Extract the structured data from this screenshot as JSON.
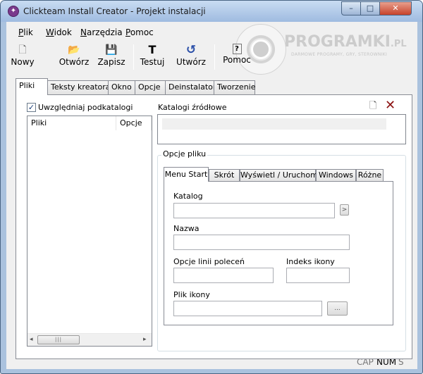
{
  "window": {
    "title": "Clickteam Install Creator - Projekt instalacji",
    "app_icon_glyph": "✦",
    "min_glyph": "–",
    "max_glyph": "□",
    "close_glyph": "✕"
  },
  "menu": [
    {
      "label": "Plik",
      "accel": "P",
      "rest": "lik"
    },
    {
      "label": "Widok",
      "accel": "W",
      "rest": "idok"
    },
    {
      "label": "Narzędzia",
      "accel": "N",
      "rest": "arzędzia"
    },
    {
      "label": "Pomoc",
      "accel": "P",
      "rest": "omoc"
    }
  ],
  "toolbar": {
    "new": {
      "label": "Nowy",
      "icon": "new-document-icon",
      "glyph": "🗋"
    },
    "open": {
      "label": "Otwórz",
      "icon": "open-folder-icon",
      "glyph": "📂"
    },
    "save": {
      "label": "Zapisz",
      "icon": "save-disk-icon",
      "glyph": "💾"
    },
    "test": {
      "label": "Testuj",
      "icon": "test-t-icon",
      "glyph": "T"
    },
    "build": {
      "label": "Utwórz",
      "icon": "build-arrow-icon",
      "glyph": "↺"
    },
    "help": {
      "label": "Pomoc",
      "icon": "help-icon",
      "glyph": "?"
    }
  },
  "watermark": {
    "main": "PROGRAMKI",
    "suffix": ".PL",
    "sub": "DARMOWE PROGRAMY, GRY, STEROWNIKI"
  },
  "tabs": [
    "Pliki",
    "Teksty kreatora",
    "Okno",
    "Opcje",
    "Deinstalator",
    "Tworzenie"
  ],
  "files_panel": {
    "include_subfolders_label": "Uwzględniaj podkatalogi",
    "include_subfolders_checked": true,
    "check_glyph": "✓",
    "columns": [
      "Pliki",
      "Opcje"
    ],
    "scroll_left_glyph": "◂",
    "scroll_right_glyph": "▸",
    "scroll_thumb_glyph": "|||"
  },
  "source_folders": {
    "label": "Katalogi źródłowe",
    "new_glyph": "🗋",
    "delete_glyph": "✕"
  },
  "file_options": {
    "group_label": "Opcje pliku",
    "tabs": [
      "Menu Start",
      "Skrót",
      "Wyświetl / Uruchom",
      "Windows",
      "Różne"
    ],
    "katalog_label": "Katalog",
    "katalog_value": "",
    "arrow_glyph": ">",
    "nazwa_label": "Nazwa",
    "nazwa_value": "",
    "cmdline_label": "Opcje linii poleceń",
    "cmdline_value": "",
    "icon_index_label": "Indeks ikony",
    "icon_index_value": "",
    "icon_file_label": "Plik ikony",
    "icon_file_value": "",
    "browse_label": "..."
  },
  "status": {
    "cap": "CAP",
    "num": "NUM",
    "scrl": "S"
  }
}
